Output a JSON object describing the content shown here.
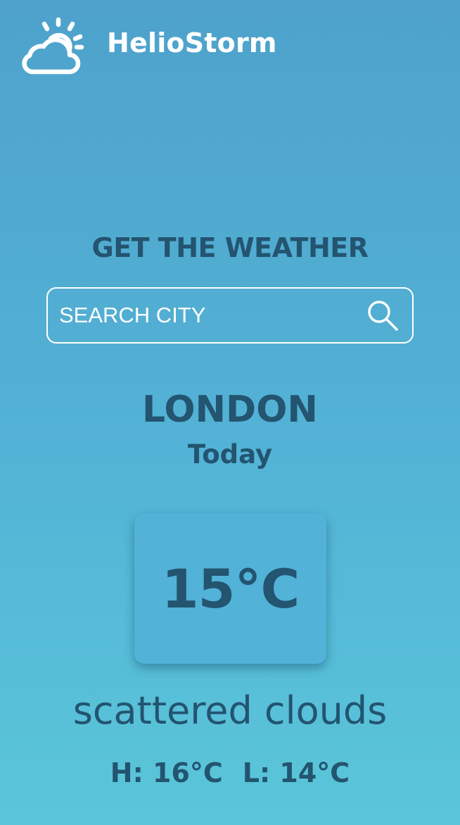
{
  "brand": {
    "name": "HelioStorm",
    "logo_icon": "sun-cloud-icon"
  },
  "search": {
    "heading": "GET THE WEATHER",
    "placeholder": "SEARCH CITY",
    "value": "",
    "icon": "search-icon"
  },
  "location": {
    "city": "LONDON",
    "day": "Today"
  },
  "weather": {
    "temperature": "15°C",
    "description": "scattered clouds",
    "high": "H: 16°C",
    "low": "L: 14°C"
  },
  "colors": {
    "background_top": "#4ea2cb",
    "background_bottom": "#5ac6d9",
    "text_primary": "#235470",
    "brand_text": "#ffffff",
    "card_background": "#52b2d7"
  }
}
